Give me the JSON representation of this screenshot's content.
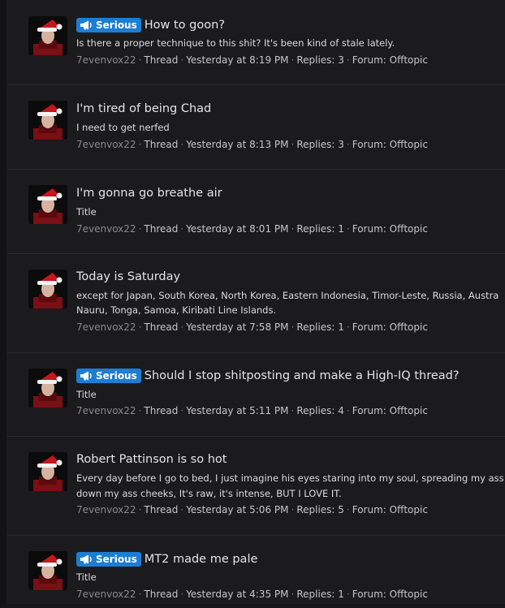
{
  "results": [
    {
      "prefix": "Serious",
      "title": "How to goon?",
      "snippet": [
        "Is there a proper technique to this shit? It's been kind of stale lately."
      ],
      "author": "7evenvox22",
      "type": "Thread",
      "date": "Yesterday at 8:19 PM",
      "replies": "Replies: 3",
      "forum": "Forum: Offtopic"
    },
    {
      "prefix": null,
      "title": "I'm tired of being Chad",
      "snippet": [
        "I need to get nerfed"
      ],
      "author": "7evenvox22",
      "type": "Thread",
      "date": "Yesterday at 8:13 PM",
      "replies": "Replies: 3",
      "forum": "Forum: Offtopic"
    },
    {
      "prefix": null,
      "title": "I'm gonna go breathe air",
      "snippet": [
        "Title"
      ],
      "author": "7evenvox22",
      "type": "Thread",
      "date": "Yesterday at 8:01 PM",
      "replies": "Replies: 1",
      "forum": "Forum: Offtopic"
    },
    {
      "prefix": null,
      "title": "Today is Saturday",
      "snippet": [
        "except for Japan, South Korea, North Korea, Eastern Indonesia, Timor-Leste, Russia, Austra",
        "Nauru, Tonga, Samoa, Kiribati Line Islands."
      ],
      "author": "7evenvox22",
      "type": "Thread",
      "date": "Yesterday at 7:58 PM",
      "replies": "Replies: 1",
      "forum": "Forum: Offtopic"
    },
    {
      "prefix": "Serious",
      "title": "Should I stop shitposting and make a High-IQ thread?",
      "snippet": [
        "Title"
      ],
      "author": "7evenvox22",
      "type": "Thread",
      "date": "Yesterday at 5:11 PM",
      "replies": "Replies: 4",
      "forum": "Forum: Offtopic"
    },
    {
      "prefix": null,
      "title": "Robert Pattinson is so hot",
      "snippet": [
        "Every day before I go to bed, I just imagine his eyes staring into my soul, spreading my ass",
        "down my ass cheeks, It's raw, it's intense, BUT I LOVE IT."
      ],
      "author": "7evenvox22",
      "type": "Thread",
      "date": "Yesterday at 5:06 PM",
      "replies": "Replies: 5",
      "forum": "Forum: Offtopic"
    },
    {
      "prefix": "Serious",
      "title": "MT2 made me pale",
      "snippet": [
        "Title"
      ],
      "author": "7evenvox22",
      "type": "Thread",
      "date": "Yesterday at 4:35 PM",
      "replies": "Replies: 1",
      "forum": "Forum: Offtopic"
    }
  ],
  "icons": {
    "prefix_icon": "megaphone-icon",
    "avatar": "santa-hat-avatar"
  },
  "colors": {
    "prefix_bg": "#1d7dd1",
    "background": "#1b1b1e"
  },
  "separator": "·"
}
